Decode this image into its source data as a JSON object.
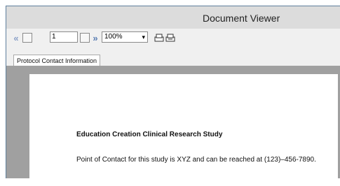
{
  "window": {
    "title": "Document Viewer"
  },
  "toolbar": {
    "first_glyph": "«",
    "prev_glyph": "‹",
    "page_value": "1",
    "next_glyph": "›",
    "last_glyph": "»",
    "zoom_value": "100%",
    "zoom_caret": "▾"
  },
  "tabs": [
    {
      "label": "Protocol Contact Information"
    }
  ],
  "document": {
    "heading": "Education Creation Clinical Research Study",
    "body": "Point of Contact for this study is XYZ and can be reached at (123)–456-7890."
  },
  "colors": {
    "nav_accent": "#5a7db3",
    "content_bg": "#a0a0a0"
  }
}
